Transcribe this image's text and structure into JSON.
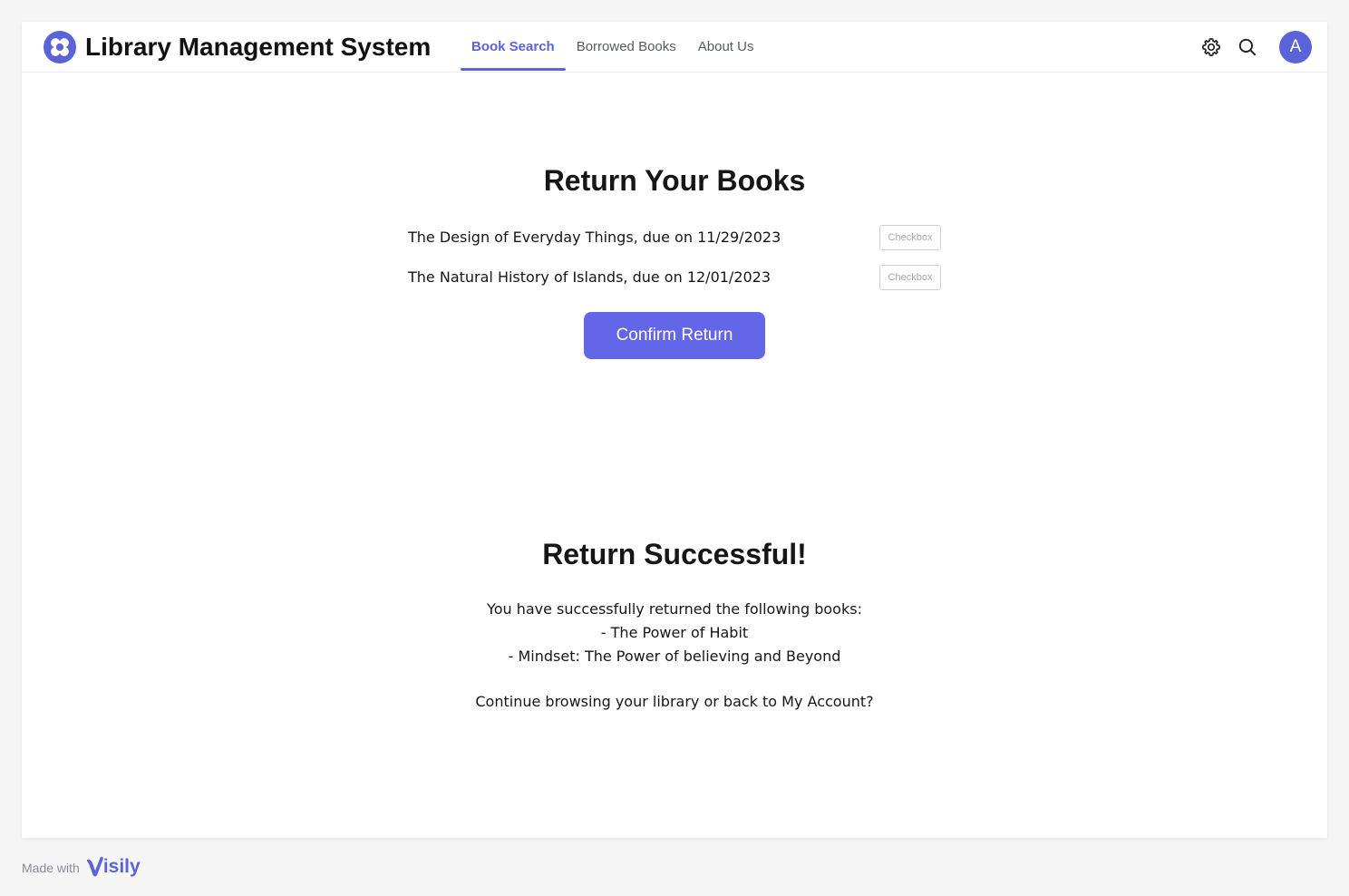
{
  "app": {
    "title": "Library Management System",
    "avatar_initial": "A"
  },
  "nav": {
    "tabs": [
      {
        "label": "Book Search",
        "active": true
      },
      {
        "label": "Borrowed Books",
        "active": false
      },
      {
        "label": "About Us",
        "active": false
      }
    ]
  },
  "icons": {
    "logo": "flower-logo-icon",
    "settings": "gear-icon",
    "search": "search-icon",
    "brand": "visily-logo-icon"
  },
  "return_section": {
    "title": "Return Your Books",
    "books": [
      {
        "text": "The Design of Everyday Things, due on 11/29/2023",
        "checkbox_label": "Checkbox"
      },
      {
        "text": "The Natural History of Islands, due on 12/01/2023",
        "checkbox_label": "Checkbox"
      }
    ],
    "confirm_button": "Confirm Return"
  },
  "success_section": {
    "title": "Return Successful!",
    "message": "You have successfully returned the following books:",
    "books": [
      "- The Power of Habit",
      "- Mindset: The Power of believing and Beyond"
    ],
    "continue_text": "Continue browsing your library or back to My Account?"
  },
  "footer": {
    "made_with": "Made with",
    "brand": "isily"
  },
  "colors": {
    "accent": "#5b63d8",
    "button": "#6366e8",
    "background": "#f5f5f6",
    "surface": "#ffffff",
    "text": "#161616"
  }
}
